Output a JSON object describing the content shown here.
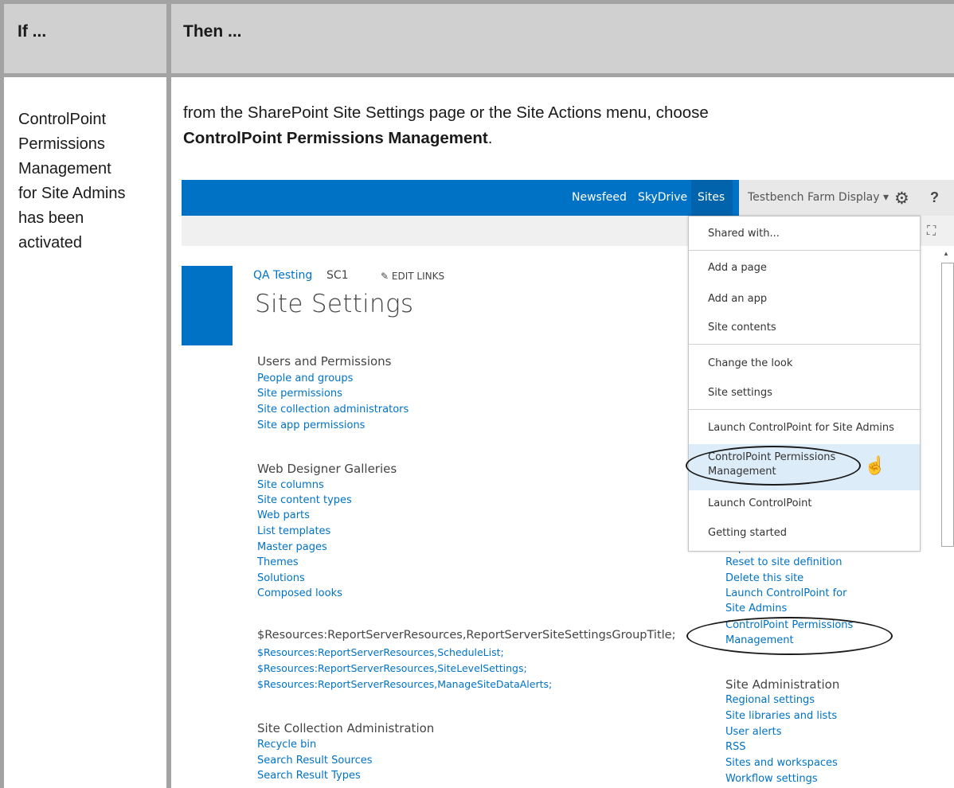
{
  "table": {
    "header": {
      "if": "If ...",
      "then": "Then ..."
    },
    "row": {
      "if_lines": [
        "ControlPoint",
        "Permissions",
        "Management",
        "for Site Admins",
        "has been",
        "activated"
      ],
      "then_line1": "from the SharePoint Site Settings page or the Site Actions menu, choose",
      "then_bold": "ControlPoint Permissions Management",
      "then_end": "."
    }
  },
  "screenshot": {
    "topnav": {
      "newsfeed": "Newsfeed",
      "skydrive": "SkyDrive",
      "sites": "Sites",
      "user": "Testbench Farm Display ▾",
      "gear_icon": "gear-icon",
      "help": "?"
    },
    "breadcrumb": {
      "site": "QA Testing",
      "sub": "SC1",
      "edit": "EDIT LINKS"
    },
    "page_title": "Site Settings",
    "left_groups": [
      {
        "title": "Users and Permissions",
        "links": [
          "People and groups",
          "Site permissions",
          "Site collection administrators",
          "Site app permissions"
        ]
      },
      {
        "title": "Web Designer Galleries",
        "links": [
          "Site columns",
          "Site content types",
          "Web parts",
          "List templates",
          "Master pages",
          "Themes",
          "Solutions",
          "Composed looks"
        ]
      },
      {
        "title": "$Resources:ReportServerResources,ReportServerSiteSettingsGroupTitle;",
        "links": [
          "$Resources:ReportServerResources,ScheduleList;",
          "$Resources:ReportServerResources,SiteLevelSettings;",
          "$Resources:ReportServerResources,ManageSiteDataAlerts;"
        ]
      },
      {
        "title": "Site Collection Administration",
        "links": [
          "Recycle bin",
          "Search Result Sources",
          "Search Result Types"
        ]
      }
    ],
    "right_links_top": [
      "Export",
      "Reset to site definition",
      "Delete this site",
      "Launch ControlPoint for",
      "Site Admins",
      "ControlPoint Permissions",
      "Management"
    ],
    "right_group": {
      "title": "Site Administration",
      "links": [
        "Regional settings",
        "Site libraries and lists",
        "User alerts",
        "RSS",
        "Sites and workspaces",
        "Workflow settings"
      ]
    },
    "menu": {
      "items": [
        "Shared with...",
        "Add a page",
        "Add an app",
        "Site contents",
        "Change the look",
        "Site settings",
        "Launch ControlPoint for Site Admins",
        "ControlPoint Permissions",
        "Management",
        "Launch ControlPoint",
        "Getting started"
      ]
    }
  }
}
